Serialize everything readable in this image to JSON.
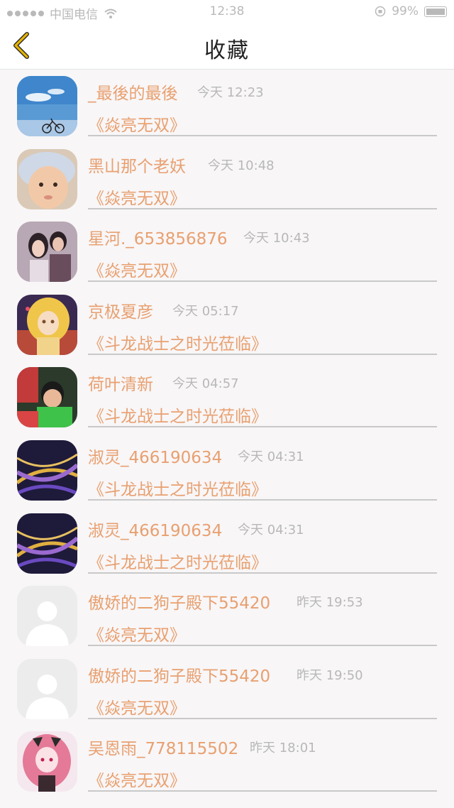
{
  "status_bar": {
    "carrier": "中国电信",
    "time": "12:38",
    "battery": "99%"
  },
  "nav": {
    "title": "收藏",
    "back_icon": "chevron-left-icon"
  },
  "colors": {
    "accent": "#e8a070",
    "back_icon": "#e6b400",
    "time_text": "#b8b8b8",
    "separator": "#c9c9c9"
  },
  "favorites": [
    {
      "user": "_最後的最後",
      "time": "今天 12:23",
      "book": "《焱亮无双》"
    },
    {
      "user": "黑山那个老妖",
      "time": "今天 10:48",
      "book": "《焱亮无双》"
    },
    {
      "user": "星河._653856876",
      "time": "今天 10:43",
      "book": "《焱亮无双》"
    },
    {
      "user": "京极夏彦",
      "time": "今天 05:17",
      "book": "《斗龙战士之时光莅临》"
    },
    {
      "user": "荷叶清新",
      "time": "今天 04:57",
      "book": "《斗龙战士之时光莅临》"
    },
    {
      "user": "淑灵_466190634",
      "time": "今天 04:31",
      "book": "《斗龙战士之时光莅临》"
    },
    {
      "user": "淑灵_466190634",
      "time": "今天 04:31",
      "book": "《斗龙战士之时光莅临》"
    },
    {
      "user": "傲娇的二狗子殿下55420",
      "time": "昨天 19:53",
      "book": "《焱亮无双》"
    },
    {
      "user": "傲娇的二狗子殿下55420",
      "time": "昨天 19:50",
      "book": "《焱亮无双》"
    },
    {
      "user": "吴恩雨_778115502",
      "time": "昨天 18:01",
      "book": "《焱亮无双》"
    }
  ]
}
